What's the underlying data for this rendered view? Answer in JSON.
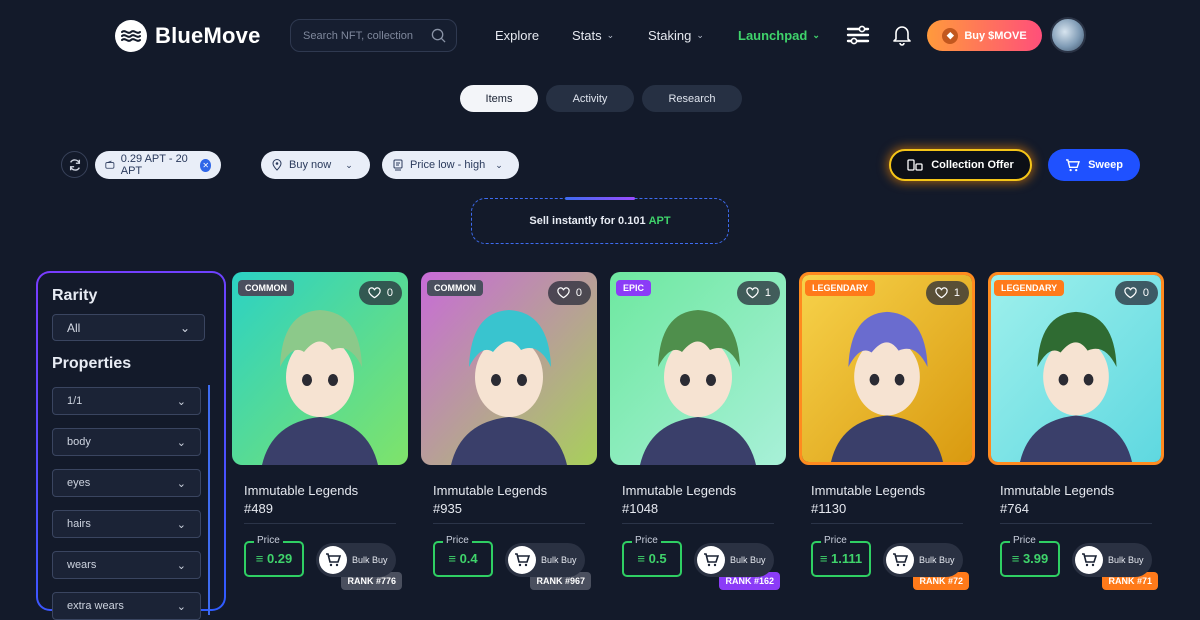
{
  "brand": {
    "name": "BlueMove"
  },
  "search": {
    "placeholder": "Search NFT, collection"
  },
  "nav": [
    {
      "label": "Explore",
      "dropdown": false
    },
    {
      "label": "Stats",
      "dropdown": true
    },
    {
      "label": "Staking",
      "dropdown": true
    },
    {
      "label": "Launchpad",
      "dropdown": true
    }
  ],
  "buy_button": {
    "label": "Buy $MOVE"
  },
  "tabs": [
    {
      "label": "Items",
      "active": true
    },
    {
      "label": "Activity",
      "active": false
    },
    {
      "label": "Research",
      "active": false
    }
  ],
  "filters": {
    "price_range": "0.29 APT - 20 APT",
    "buy_mode": "Buy now",
    "sort": "Price low - high"
  },
  "actions": {
    "collection_offer": "Collection Offer",
    "sweep": "Sweep"
  },
  "sell_instantly": {
    "text": "Sell instantly for 0.101",
    "currency": "APT"
  },
  "sidebar": {
    "rarity_heading": "Rarity",
    "rarity_value": "All",
    "properties_heading": "Properties",
    "properties": [
      "1/1",
      "body",
      "eyes",
      "hairs",
      "wears",
      "extra wears"
    ]
  },
  "price_label": "Price",
  "bulk_label": "Bulk Buy",
  "cards": [
    {
      "name": "Immutable Legends",
      "number": "#489",
      "rarity": "COMMON",
      "rank": "RANK #776",
      "likes": "0",
      "price": "0.29",
      "bg": [
        "#2bd2c4",
        "#7fe36a"
      ],
      "hair": "#8cc98a"
    },
    {
      "name": "Immutable Legends",
      "number": "#935",
      "rarity": "COMMON",
      "rank": "RANK #967",
      "likes": "0",
      "price": "0.4",
      "bg": [
        "#c86bd8",
        "#a8d05a"
      ],
      "hair": "#39c4cf"
    },
    {
      "name": "Immutable Legends",
      "number": "#1048",
      "rarity": "EPIC",
      "rank": "RANK #162",
      "likes": "1",
      "price": "0.5",
      "bg": [
        "#6ee8a0",
        "#a8f0d8"
      ],
      "hair": "#4f8f4c"
    },
    {
      "name": "Immutable Legends",
      "number": "#1130",
      "rarity": "LEGENDARY",
      "rank": "RANK #72",
      "likes": "1",
      "price": "1.111",
      "bg": [
        "#f7d24a",
        "#d99a10"
      ],
      "hair": "#6a6ccf"
    },
    {
      "name": "Immutable Legends",
      "number": "#764",
      "rarity": "LEGENDARY",
      "rank": "RANK #71",
      "likes": "0",
      "price": "3.99",
      "bg": [
        "#9ef0ec",
        "#5fd8e0"
      ],
      "hair": "#2f6b32"
    }
  ]
}
